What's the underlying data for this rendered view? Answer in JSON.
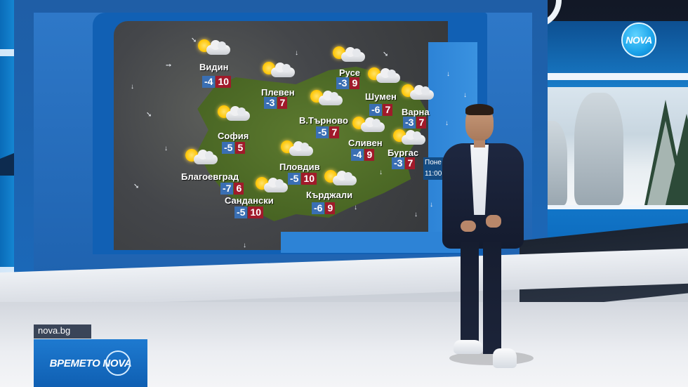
{
  "channel": {
    "logo_text": "NOVA"
  },
  "lower_third": {
    "url": "nova.bg",
    "brand": "ВРЕМЕТО NOVA"
  },
  "map": {
    "side_text_line1": "Поне",
    "side_text_line2": "11:00",
    "cities": [
      {
        "name": "Видин",
        "min": "-4",
        "max": "10"
      },
      {
        "name": "Плевен",
        "min": "-3",
        "max": "7"
      },
      {
        "name": "Русе",
        "min": "-3",
        "max": "9"
      },
      {
        "name": "Шумен",
        "min": "-6",
        "max": "7"
      },
      {
        "name": "Варна",
        "min": "-3",
        "max": "7"
      },
      {
        "name": "В.Търново",
        "min": "-5",
        "max": "7"
      },
      {
        "name": "София",
        "min": "-5",
        "max": "5"
      },
      {
        "name": "Сливен",
        "min": "-4",
        "max": "9"
      },
      {
        "name": "Бургас",
        "min": "-3",
        "max": "7"
      },
      {
        "name": "Благоевград",
        "min": "-7",
        "max": "6"
      },
      {
        "name": "Пловдив",
        "min": "-5",
        "max": "10"
      },
      {
        "name": "Кърджали",
        "min": "-6",
        "max": "9"
      },
      {
        "name": "Сандански",
        "min": "-5",
        "max": "10"
      }
    ]
  },
  "colors": {
    "min_temp_bg": "#3a6fb3",
    "max_temp_bg": "#a01a2a",
    "map_frame": "#1160b4"
  }
}
